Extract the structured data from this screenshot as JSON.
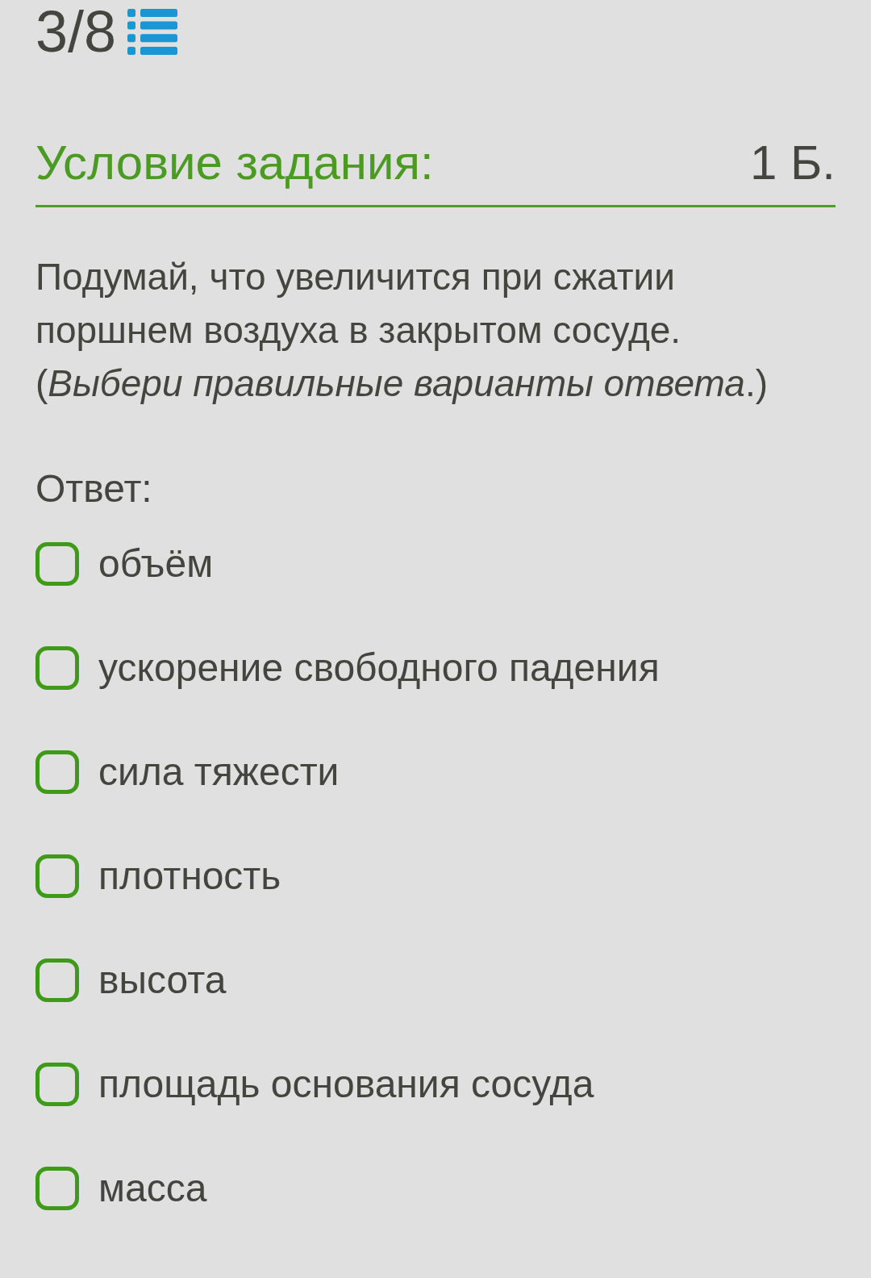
{
  "progress": {
    "text": "3/8"
  },
  "task": {
    "title": "Условие задания:",
    "points": "1 Б."
  },
  "question": {
    "text": "Подумай, что увеличится при сжатии поршнем воздуха в закрытом сосуде.",
    "instruction": "(*Выбери правильные варианты ответа*.)"
  },
  "answer": {
    "label": "Ответ:",
    "options": [
      {
        "label": "объём",
        "checked": false
      },
      {
        "label": "ускорение свободного падения",
        "checked": false
      },
      {
        "label": "сила тяжести",
        "checked": false
      },
      {
        "label": "плотность",
        "checked": false
      },
      {
        "label": "высота",
        "checked": false
      },
      {
        "label": "площадь основания сосуда",
        "checked": false
      },
      {
        "label": "масса",
        "checked": false
      }
    ]
  }
}
